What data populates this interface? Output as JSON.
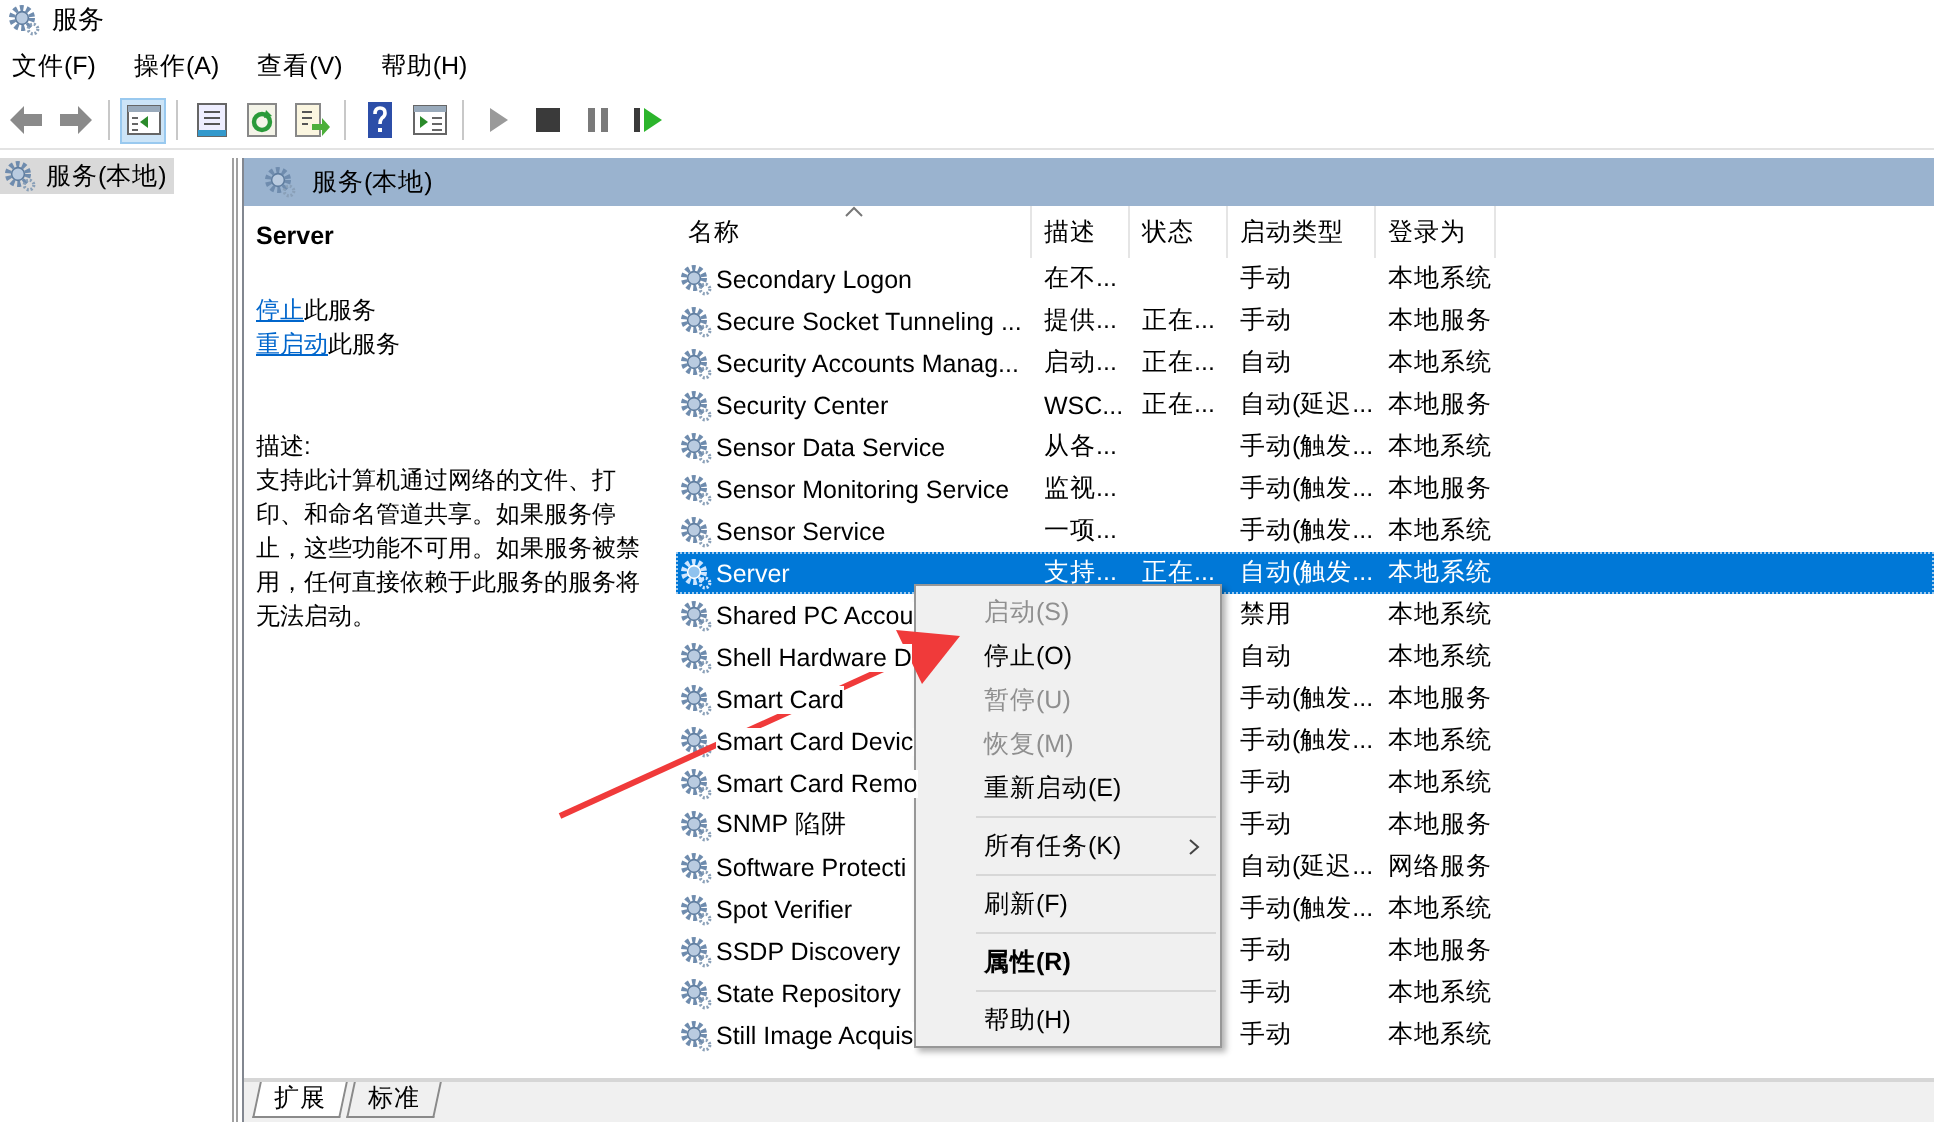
{
  "window": {
    "title": "服务"
  },
  "menu": [
    "文件(F)",
    "操作(A)",
    "查看(V)",
    "帮助(H)"
  ],
  "toolbar": [
    {
      "kind": "back",
      "pressed": false
    },
    {
      "kind": "forward",
      "pressed": false
    },
    {
      "kind": "separator"
    },
    {
      "kind": "tree_toggle",
      "pressed": true
    },
    {
      "kind": "separator"
    },
    {
      "kind": "properties",
      "pressed": false
    },
    {
      "kind": "refresh",
      "pressed": false
    },
    {
      "kind": "export",
      "pressed": false
    },
    {
      "kind": "separator"
    },
    {
      "kind": "help",
      "pressed": false
    },
    {
      "kind": "action_pane",
      "pressed": false
    },
    {
      "kind": "separator"
    },
    {
      "kind": "play",
      "pressed": false
    },
    {
      "kind": "stop",
      "pressed": false
    },
    {
      "kind": "pause",
      "pressed": false
    },
    {
      "kind": "resume",
      "pressed": false
    }
  ],
  "tree": {
    "items": [
      {
        "label": "服务(本地)",
        "selected": true
      }
    ]
  },
  "header": {
    "title": "服务(本地)"
  },
  "details": {
    "service_name": "Server",
    "actions": [
      {
        "link": "停止",
        "text": "此服务"
      },
      {
        "link": "重启动",
        "text": "此服务"
      }
    ],
    "description_label": "描述:",
    "description": "支持此计算机通过网络的文件、打印、和命名管道共享。如果服务停止，这些功能不可用。如果服务被禁用，任何直接依赖于此服务的服务将无法启动。"
  },
  "table": {
    "columns": [
      {
        "label": "名称",
        "sorted": true
      },
      {
        "label": "描述",
        "sorted": false
      },
      {
        "label": "状态",
        "sorted": false
      },
      {
        "label": "启动类型",
        "sorted": false
      },
      {
        "label": "登录为",
        "sorted": false
      }
    ],
    "rows": [
      {
        "name": "Secondary Logon",
        "description": "在不...",
        "startup": "手动",
        "logon": "本地系统",
        "selected": false
      },
      {
        "name": "Secure Socket Tunneling ...",
        "description": "提供...",
        "status": "正在...",
        "startup": "手动",
        "logon": "本地服务",
        "selected": false
      },
      {
        "name": "Security Accounts Manag...",
        "description": "启动...",
        "status": "正在...",
        "startup": "自动",
        "logon": "本地系统",
        "selected": false
      },
      {
        "name": "Security Center",
        "description": "WSC...",
        "status": "正在...",
        "startup": "自动(延迟...",
        "logon": "本地服务",
        "selected": false
      },
      {
        "name": "Sensor Data Service",
        "description": "从各...",
        "startup": "手动(触发...",
        "logon": "本地系统",
        "selected": false
      },
      {
        "name": "Sensor Monitoring Service",
        "description": "监视...",
        "startup": "手动(触发...",
        "logon": "本地服务",
        "selected": false
      },
      {
        "name": "Sensor Service",
        "description": "一项...",
        "startup": "手动(触发...",
        "logon": "本地系统",
        "selected": false
      },
      {
        "name": "Server",
        "description": "支持...",
        "status": "正在...",
        "startup": "自动(触发...",
        "logon": "本地系统",
        "selected": true
      },
      {
        "name": "Shared PC Accou",
        "startup": "禁用",
        "logon": "本地系统",
        "selected": false
      },
      {
        "name": "Shell Hardware D",
        "startup": "自动",
        "logon": "本地系统",
        "selected": false
      },
      {
        "name": "Smart Card",
        "startup": "手动(触发...",
        "logon": "本地服务",
        "selected": false
      },
      {
        "name": "Smart Card Devic",
        "startup": "手动(触发...",
        "logon": "本地系统",
        "selected": false
      },
      {
        "name": "Smart Card Remo",
        "startup": "手动",
        "logon": "本地系统",
        "selected": false
      },
      {
        "name": "SNMP 陷阱",
        "startup": "手动",
        "logon": "本地服务",
        "selected": false
      },
      {
        "name": "Software Protecti",
        "startup": "自动(延迟...",
        "logon": "网络服务",
        "selected": false
      },
      {
        "name": "Spot Verifier",
        "startup": "手动(触发...",
        "logon": "本地系统",
        "selected": false
      },
      {
        "name": "SSDP Discovery",
        "startup": "手动",
        "logon": "本地服务",
        "selected": false
      },
      {
        "name": "State Repository",
        "startup": "手动",
        "logon": "本地系统",
        "selected": false
      },
      {
        "name": "Still Image Acquis",
        "startup": "手动",
        "logon": "本地系统",
        "selected": false
      }
    ]
  },
  "context_menu": {
    "items": [
      {
        "kind": "item",
        "label": "启动(S)",
        "disabled": true,
        "default": false,
        "submenu": false
      },
      {
        "kind": "item",
        "label": "停止(O)",
        "disabled": false,
        "default": false,
        "submenu": false
      },
      {
        "kind": "item",
        "label": "暂停(U)",
        "disabled": true,
        "default": false,
        "submenu": false
      },
      {
        "kind": "item",
        "label": "恢复(M)",
        "disabled": true,
        "default": false,
        "submenu": false
      },
      {
        "kind": "item",
        "label": "重新启动(E)",
        "disabled": false,
        "default": false,
        "submenu": false
      },
      {
        "kind": "separator"
      },
      {
        "kind": "item",
        "label": "所有任务(K)",
        "disabled": false,
        "default": false,
        "submenu": true
      },
      {
        "kind": "separator"
      },
      {
        "kind": "item",
        "label": "刷新(F)",
        "disabled": false,
        "default": false,
        "submenu": false
      },
      {
        "kind": "separator"
      },
      {
        "kind": "item",
        "label": "属性(R)",
        "disabled": false,
        "default": true,
        "submenu": false
      },
      {
        "kind": "separator"
      },
      {
        "kind": "item",
        "label": "帮助(H)",
        "disabled": false,
        "default": false,
        "submenu": false
      }
    ]
  },
  "bottom_tabs": [
    {
      "label": "扩展",
      "selected": true
    },
    {
      "label": "标准",
      "selected": false
    }
  ]
}
